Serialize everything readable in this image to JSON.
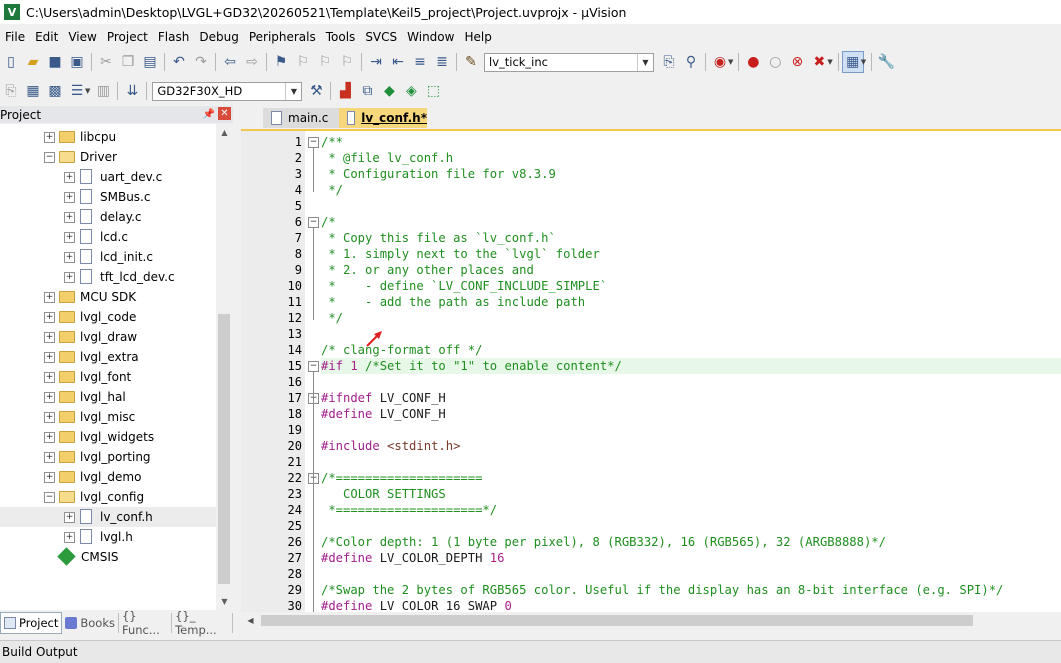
{
  "window": {
    "title": "C:\\Users\\admin\\Desktop\\LVGL+GD32\\20260521\\Template\\Keil5_project\\Project.uvprojx - µVision"
  },
  "menu": [
    "File",
    "Edit",
    "View",
    "Project",
    "Flash",
    "Debug",
    "Peripherals",
    "Tools",
    "SVCS",
    "Window",
    "Help"
  ],
  "toolbar": {
    "find_combo": "lv_tick_inc",
    "target_combo": "GD32F30X_HD"
  },
  "project_panel": {
    "title": "Project",
    "tree": [
      {
        "label": "libcpu",
        "type": "folder",
        "level": 1,
        "state": "collapsed"
      },
      {
        "label": "Driver",
        "type": "folder",
        "level": 1,
        "state": "expanded"
      },
      {
        "label": "uart_dev.c",
        "type": "file",
        "level": 2
      },
      {
        "label": "SMBus.c",
        "type": "file",
        "level": 2
      },
      {
        "label": "delay.c",
        "type": "file",
        "level": 2
      },
      {
        "label": "lcd.c",
        "type": "file",
        "level": 2
      },
      {
        "label": "lcd_init.c",
        "type": "file",
        "level": 2
      },
      {
        "label": "tft_lcd_dev.c",
        "type": "file",
        "level": 2
      },
      {
        "label": "MCU SDK",
        "type": "folder",
        "level": 1,
        "state": "collapsed"
      },
      {
        "label": "lvgl_code",
        "type": "folder",
        "level": 1,
        "state": "collapsed"
      },
      {
        "label": "lvgl_draw",
        "type": "folder",
        "level": 1,
        "state": "collapsed"
      },
      {
        "label": "lvgl_extra",
        "type": "folder",
        "level": 1,
        "state": "collapsed"
      },
      {
        "label": "lvgl_font",
        "type": "folder",
        "level": 1,
        "state": "collapsed"
      },
      {
        "label": "lvgl_hal",
        "type": "folder",
        "level": 1,
        "state": "collapsed"
      },
      {
        "label": "lvgl_misc",
        "type": "folder",
        "level": 1,
        "state": "collapsed"
      },
      {
        "label": "lvgl_widgets",
        "type": "folder",
        "level": 1,
        "state": "collapsed"
      },
      {
        "label": "lvgl_porting",
        "type": "folder",
        "level": 1,
        "state": "collapsed"
      },
      {
        "label": "lvgl_demo",
        "type": "folder",
        "level": 1,
        "state": "collapsed"
      },
      {
        "label": "lvgl_config",
        "type": "folder",
        "level": 1,
        "state": "expanded"
      },
      {
        "label": "lv_conf.h",
        "type": "file",
        "level": 2,
        "selected": true
      },
      {
        "label": "lvgl.h",
        "type": "file",
        "level": 2
      },
      {
        "label": "CMSIS",
        "type": "component",
        "level": 1
      }
    ],
    "tabs": [
      "Project",
      "Books",
      "{} Func...",
      "{}_ Temp..."
    ]
  },
  "editor": {
    "tabs": [
      {
        "label": "main.c",
        "active": false
      },
      {
        "label": "lv_conf.h*",
        "active": true
      }
    ],
    "current_line": 15,
    "lines": [
      {
        "n": "1",
        "fold": "minus",
        "parts": [
          {
            "c": "cmt",
            "t": "/**"
          }
        ]
      },
      {
        "n": "2",
        "parts": [
          {
            "c": "cmt",
            "t": " * @file lv_conf.h"
          }
        ]
      },
      {
        "n": "3",
        "parts": [
          {
            "c": "cmt",
            "t": " * Configuration file for v8.3.9"
          }
        ]
      },
      {
        "n": "4",
        "parts": [
          {
            "c": "cmt",
            "t": " */"
          }
        ]
      },
      {
        "n": "5",
        "parts": []
      },
      {
        "n": "6",
        "fold": "minus",
        "parts": [
          {
            "c": "cmt",
            "t": "/*"
          }
        ]
      },
      {
        "n": "7",
        "parts": [
          {
            "c": "cmt",
            "t": " * Copy this file as `lv_conf.h`"
          }
        ]
      },
      {
        "n": "8",
        "parts": [
          {
            "c": "cmt",
            "t": " * 1. simply next to the `lvgl` folder"
          }
        ]
      },
      {
        "n": "9",
        "parts": [
          {
            "c": "cmt",
            "t": " * 2. or any other places and"
          }
        ]
      },
      {
        "n": "10",
        "parts": [
          {
            "c": "cmt",
            "t": " *    - define `LV_CONF_INCLUDE_SIMPLE`"
          }
        ]
      },
      {
        "n": "11",
        "parts": [
          {
            "c": "cmt",
            "t": " *    - add the path as include path"
          }
        ]
      },
      {
        "n": "12",
        "parts": [
          {
            "c": "cmt",
            "t": " */"
          }
        ]
      },
      {
        "n": "13",
        "parts": []
      },
      {
        "n": "14",
        "parts": [
          {
            "c": "cmt",
            "t": "/* clang-format off */"
          }
        ]
      },
      {
        "n": "15",
        "fold": "minus",
        "parts": [
          {
            "c": "pp",
            "t": "#if "
          },
          {
            "c": "num",
            "t": "1"
          },
          {
            "c": "cmt",
            "t": " /*Set it to \"1\" to enable content*/"
          }
        ]
      },
      {
        "n": "16",
        "parts": []
      },
      {
        "n": "17",
        "fold": "minus",
        "parts": [
          {
            "c": "pp",
            "t": "#ifndef "
          },
          {
            "c": "def",
            "t": "LV_CONF_H"
          }
        ]
      },
      {
        "n": "18",
        "parts": [
          {
            "c": "pp",
            "t": "#define "
          },
          {
            "c": "def",
            "t": "LV_CONF_H"
          }
        ]
      },
      {
        "n": "19",
        "parts": []
      },
      {
        "n": "20",
        "parts": [
          {
            "c": "pp",
            "t": "#include "
          },
          {
            "c": "str",
            "t": "<stdint.h>"
          }
        ]
      },
      {
        "n": "21",
        "parts": []
      },
      {
        "n": "22",
        "fold": "minus",
        "parts": [
          {
            "c": "cmt",
            "t": "/*===================="
          }
        ]
      },
      {
        "n": "23",
        "parts": [
          {
            "c": "cmt",
            "t": "   COLOR SETTINGS"
          }
        ]
      },
      {
        "n": "24",
        "parts": [
          {
            "c": "cmt",
            "t": " *====================*/"
          }
        ]
      },
      {
        "n": "25",
        "parts": []
      },
      {
        "n": "26",
        "parts": [
          {
            "c": "cmt",
            "t": "/*Color depth: 1 (1 byte per pixel), 8 (RGB332), 16 (RGB565), 32 (ARGB8888)*/"
          }
        ]
      },
      {
        "n": "27",
        "parts": [
          {
            "c": "pp",
            "t": "#define "
          },
          {
            "c": "def",
            "t": "LV_COLOR_DEPTH "
          },
          {
            "c": "num",
            "t": "16"
          }
        ]
      },
      {
        "n": "28",
        "parts": []
      },
      {
        "n": "29",
        "parts": [
          {
            "c": "cmt",
            "t": "/*Swap the 2 bytes of RGB565 color. Useful if the display has an 8-bit interface (e.g. SPI)*/"
          }
        ]
      },
      {
        "n": "30",
        "parts": [
          {
            "c": "pp",
            "t": "#define "
          },
          {
            "c": "def",
            "t": "LV_COLOR_16_SWAP "
          },
          {
            "c": "num",
            "t": "0"
          }
        ]
      }
    ]
  },
  "build_output": {
    "title": "Build Output"
  },
  "colors": {
    "comment": "#1f8f1f",
    "preprocessor": "#a01e8a",
    "active_tab": "#f7d77c",
    "current_line": "#e8f8e8"
  }
}
